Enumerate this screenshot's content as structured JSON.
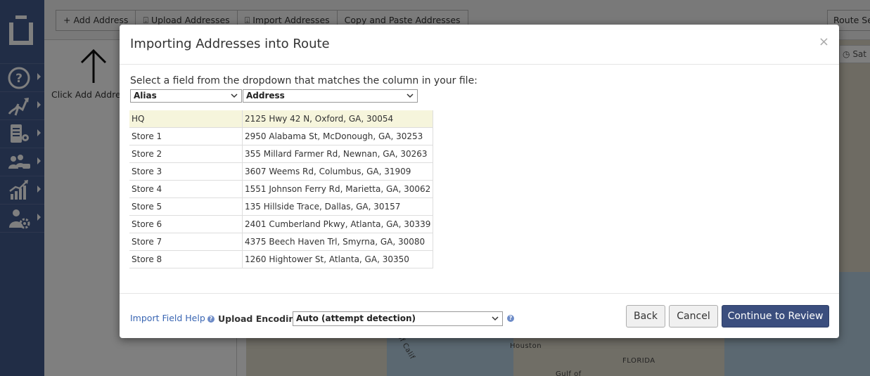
{
  "app": {
    "toolbar": [
      {
        "label": "Add Address",
        "icon": "plus-icon"
      },
      {
        "label": "Upload Addresses",
        "icon": "upload-icon"
      },
      {
        "label": "Import Addresses",
        "icon": "import-icon"
      },
      {
        "label": "Copy and Paste Addresses",
        "icon": ""
      }
    ],
    "route_settings_label": "Route Set",
    "hint_text": "Click Add Address",
    "map": {
      "satellite_label": "Sat",
      "labels": [
        "Houston",
        "FLORIDA",
        "Gulf of Calif",
        "Gulf of"
      ]
    },
    "sidebar_icons": [
      "help-icon",
      "routes-icon",
      "route-plan-icon",
      "team-icon",
      "analytics-icon",
      "settings-icon"
    ]
  },
  "modal": {
    "title": "Importing Addresses into Route",
    "close_glyph": "×",
    "instruction": "Select a field from the dropdown that matches the column in your file:",
    "column_selects": [
      "Alias",
      "Address"
    ],
    "rows": [
      {
        "alias": "HQ",
        "address": "2125 Hwy 42 N, Oxford, GA, 30054"
      },
      {
        "alias": "Store 1",
        "address": "2950 Alabama St, McDonough, GA, 30253"
      },
      {
        "alias": "Store 2",
        "address": "355 Millard Farmer Rd, Newnan, GA, 30263"
      },
      {
        "alias": "Store 3",
        "address": "3607 Weems Rd, Columbus, GA, 31909"
      },
      {
        "alias": "Store 4",
        "address": "1551 Johnson Ferry Rd, Marietta, GA, 30062"
      },
      {
        "alias": "Store 5",
        "address": "135 Hillside Trace, Dallas, GA, 30157"
      },
      {
        "alias": "Store 6",
        "address": "2401 Cumberland Pkwy, Atlanta, GA, 30339"
      },
      {
        "alias": "Store 7",
        "address": "4375 Beech Haven Trl, Smyrna, GA, 30080"
      },
      {
        "alias": "Store 8",
        "address": "1260 Hightower St, Atlanta, GA, 30350"
      }
    ],
    "footer": {
      "help_link": "Import Field Help",
      "encoding_label": "Upload Encoding:",
      "encoding_value": "Auto (attempt detection)",
      "back": "Back",
      "cancel": "Cancel",
      "continue": "Continue to Review"
    }
  },
  "colors": {
    "sidebar": "#435a8c",
    "primary_button": "#3b4e7e",
    "highlight_row": "#f6f5dc",
    "link": "#3a66b3"
  }
}
